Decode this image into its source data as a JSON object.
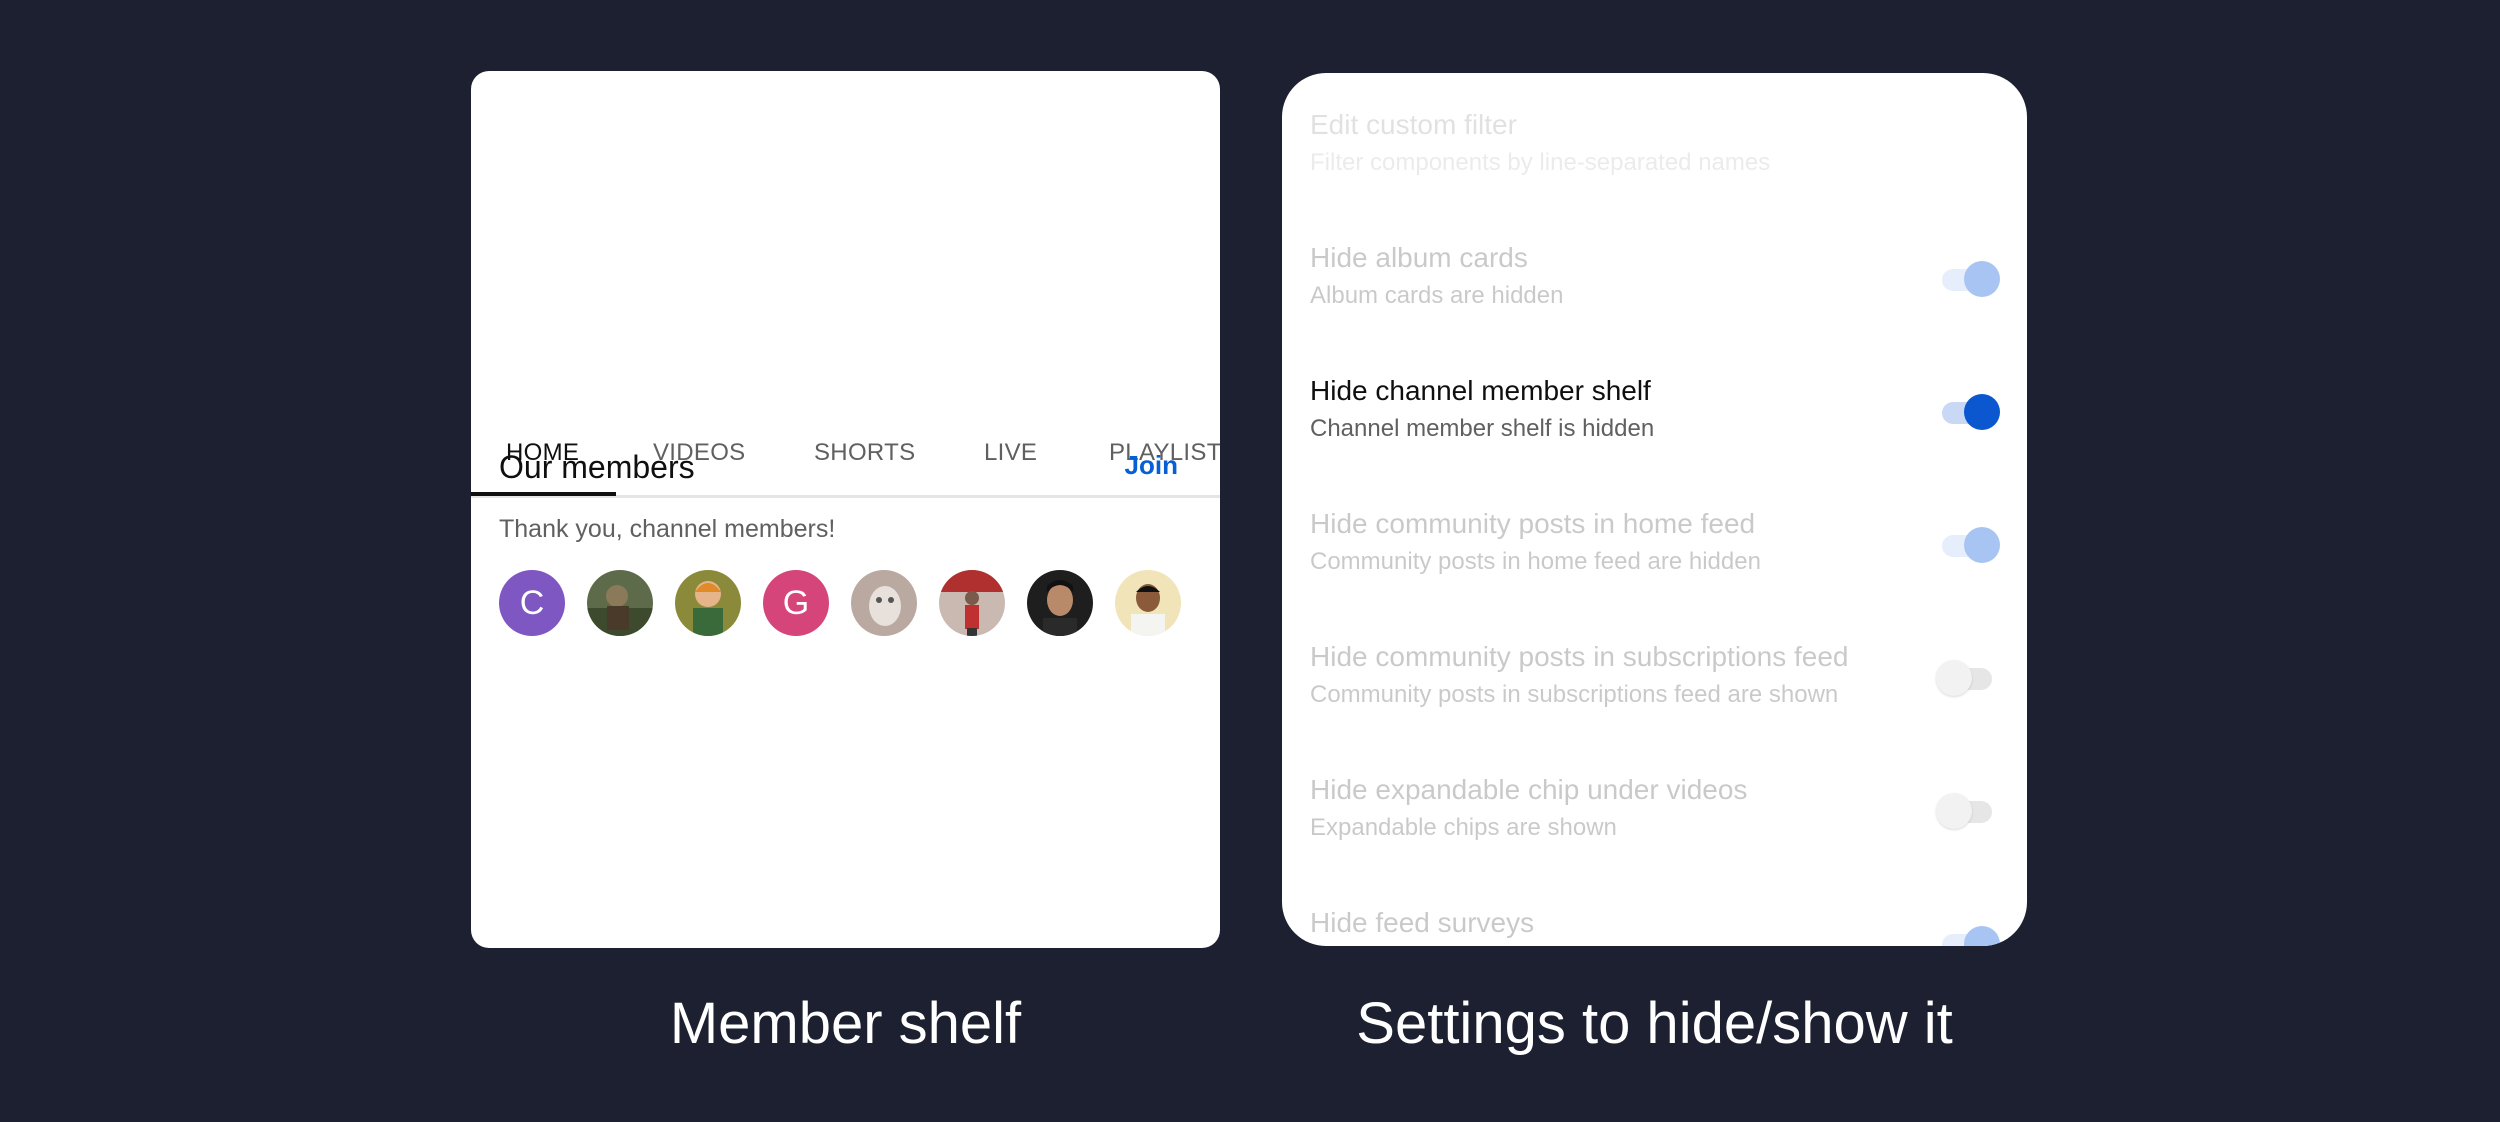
{
  "left_panel": {
    "tabs": [
      {
        "label": "HOME"
      },
      {
        "label": "VIDEOS"
      },
      {
        "label": "SHORTS"
      },
      {
        "label": "LIVE"
      },
      {
        "label": "PLAYLISTS"
      }
    ],
    "shelf": {
      "title": "Our members",
      "join_label": "Join",
      "subtitle": "Thank you, channel members!",
      "avatars": [
        {
          "letter": "C",
          "color": "#7e57c2"
        },
        {
          "letter": "",
          "color": "#5d6b4a"
        },
        {
          "letter": "",
          "color": "#8a8a3a"
        },
        {
          "letter": "G",
          "color": "#d6457a"
        },
        {
          "letter": "",
          "color": "#b9a9a0"
        },
        {
          "letter": "",
          "color": "#9a8a8a"
        },
        {
          "letter": "",
          "color": "#1e1e1e"
        },
        {
          "letter": "",
          "color": "#f0e4b8"
        }
      ]
    }
  },
  "right_panel": {
    "settings": [
      {
        "title": "Edit custom filter",
        "subtitle": "Filter components by line-separated names",
        "toggle": "none"
      },
      {
        "title": "Hide album cards",
        "subtitle": "Album cards are hidden",
        "toggle": "on"
      },
      {
        "title": "Hide channel member shelf",
        "subtitle": "Channel member shelf is hidden",
        "toggle": "on"
      },
      {
        "title": "Hide community posts in home feed",
        "subtitle": "Community posts in home feed are hidden",
        "toggle": "on"
      },
      {
        "title": "Hide community posts in subscriptions feed",
        "subtitle": "Community posts in subscriptions feed are shown",
        "toggle": "off"
      },
      {
        "title": "Hide expandable chip under videos",
        "subtitle": "Expandable chips are shown",
        "toggle": "off"
      },
      {
        "title": "Hide feed surveys",
        "subtitle": "",
        "toggle": "on"
      }
    ]
  },
  "captions": {
    "left": "Member shelf",
    "right": "Settings to hide/show it"
  },
  "colors": {
    "background": "#1c2030",
    "accent": "#0b57d0",
    "join": "#065fd4"
  }
}
